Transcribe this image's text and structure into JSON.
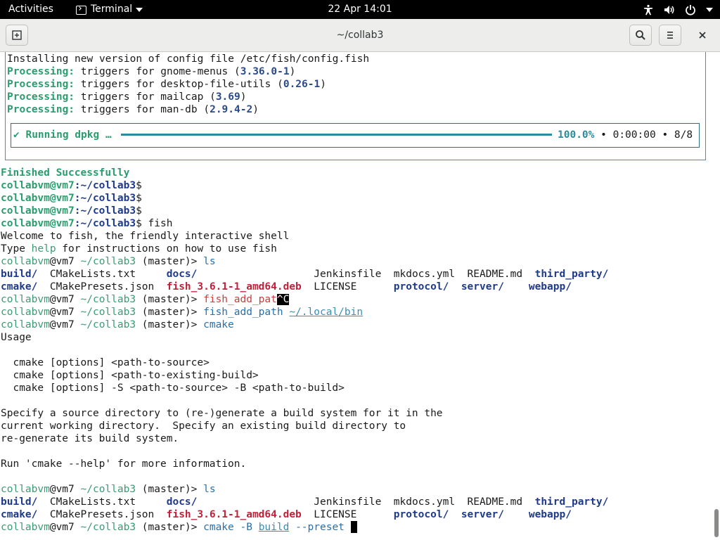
{
  "topbar": {
    "activities": "Activities",
    "app_name": "Terminal",
    "clock": "22 Apr  14:01"
  },
  "window": {
    "title": "~/collab3"
  },
  "terminal": {
    "dpkg": {
      "l1": "Installing new version of config file /etc/fish/config.fish",
      "processing": "Processing:",
      "l2_text": " triggers for gnome-menus (",
      "l2_ver": "3.36.0-1",
      "l3_text": " triggers for desktop-file-utils (",
      "l3_ver": "0.26-1",
      "l4_text": " triggers for mailcap (",
      "l4_ver": "3.69",
      "l5_text": " triggers for man-db (",
      "l5_ver": "2.9.4-2",
      "close_paren": ")",
      "running": "✔ Running dpkg …",
      "percent": "100.0%",
      "bullet": "•",
      "elapsed": "0:00:00",
      "count": "8/8",
      "progress": 1.0
    },
    "finished": "Finished Successfully",
    "bash_user": "collabvm@vm7",
    "bash_path": ":~/collab3",
    "bash_sign": "$",
    "fish_cmd": " fish",
    "welcome": "Welcome to fish, the friendly interactive shell",
    "type_pre": "Type ",
    "help": "help",
    "type_post": " for instructions on how to use fish",
    "fish_user": "collabvm",
    "fish_host": "@vm7 ",
    "fish_path": "~/collab3",
    "fish_branch": " (master)> ",
    "cmd_ls": "ls",
    "ls": {
      "r1": [
        "build/",
        "CMakeLists.txt",
        "docs/",
        "Jenkinsfile",
        "mkdocs.yml",
        "README.md",
        "third_party/"
      ],
      "r2": [
        "cmake/",
        "CMakePresets.json",
        "fish_3.6.1-1_amd64.deb",
        "LICENSE",
        "protocol/",
        "server/",
        "webapp/"
      ]
    },
    "cmd_fap_partial": "fish_add_pat",
    "ctrl_c": "^C",
    "cmd_fap": "fish_add_path",
    "fap_arg": "~/.local/bin",
    "cmd_cmake": "cmake",
    "usage": "Usage",
    "u1": "  cmake [options] <path-to-source>",
    "u2": "  cmake [options] <path-to-existing-build>",
    "u3": "  cmake [options] -S <path-to-source> -B <path-to-build>",
    "s1": "Specify a source directory to (re-)generate a build system for it in the",
    "s2": "current working directory.  Specify an existing build directory to",
    "s3": "re-generate its build system.",
    "run": "Run 'cmake --help' for more information.",
    "last_cmd": "cmake",
    "last_b": " -B ",
    "last_build": "build",
    "last_preset": " --preset "
  }
}
